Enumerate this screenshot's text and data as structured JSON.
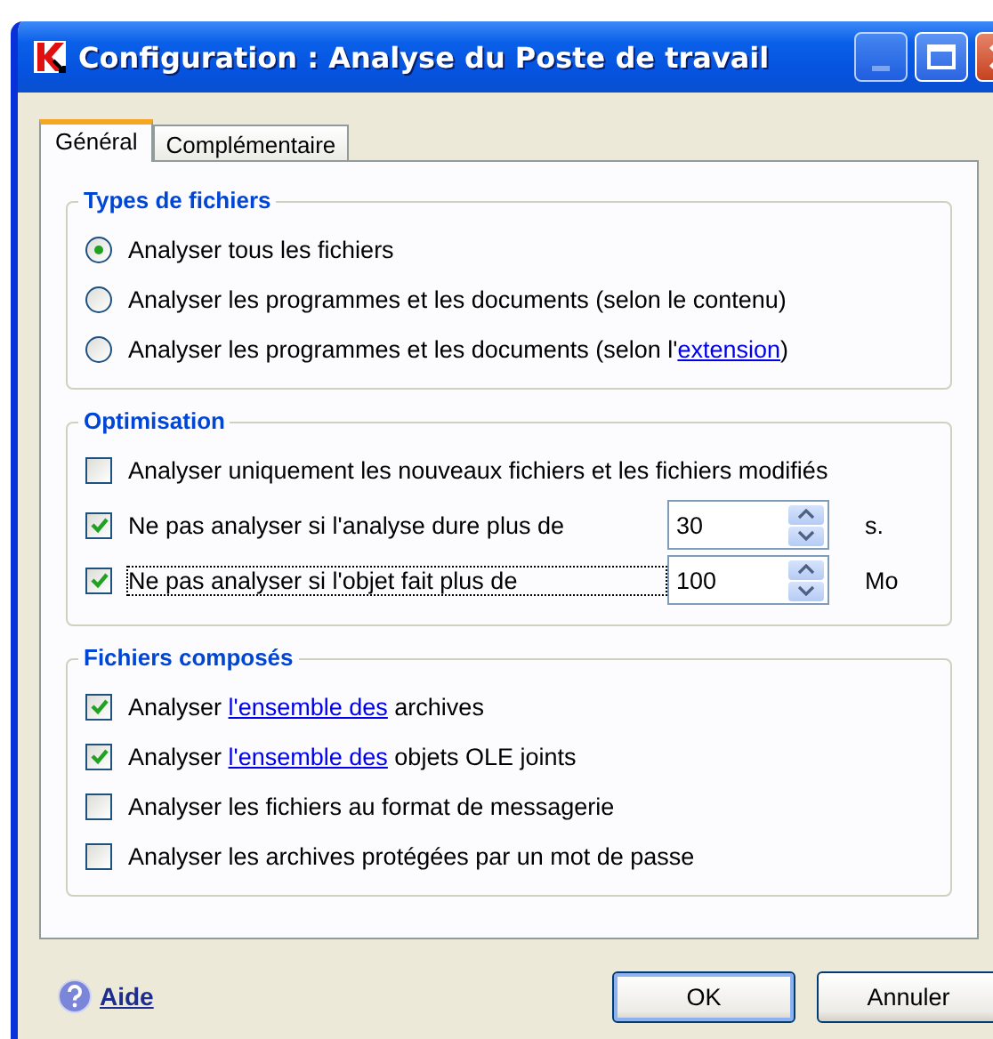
{
  "window": {
    "title": "Configuration : Analyse du Poste de travail"
  },
  "tabs": [
    {
      "label": "Général",
      "selected": true
    },
    {
      "label": "Complémentaire",
      "selected": false
    }
  ],
  "groups": [
    {
      "title": "Types de fichiers",
      "items": [
        {
          "kind": "radio",
          "text": "Analyser tous les fichiers",
          "selected": true
        },
        {
          "kind": "radio",
          "text": "Analyser les programmes et les documents (selon le contenu)",
          "selected": false
        },
        {
          "kind": "radio",
          "text": "Analyser les programmes et les documents (selon l'",
          "link": "extension",
          "after": ")",
          "selected": false
        }
      ]
    },
    {
      "title": "Optimisation",
      "items": [
        {
          "kind": "checkbox",
          "text": "Analyser uniquement les nouveaux fichiers et les fichiers modifiés",
          "checked": false
        },
        {
          "kind": "spin",
          "text": "Ne pas analyser si l'analyse dure plus de",
          "checked": true,
          "value": "30",
          "unit": "s.",
          "focused": false
        },
        {
          "kind": "spin",
          "text": "Ne pas analyser si l'objet fait plus de",
          "checked": true,
          "value": "100",
          "unit": "Mo",
          "focused": true
        }
      ]
    },
    {
      "title": "Fichiers composés",
      "items": [
        {
          "kind": "checkbox",
          "text": "Analyser ",
          "link": "l'ensemble des",
          "after": " archives",
          "checked": true
        },
        {
          "kind": "checkbox",
          "text": "Analyser ",
          "link": "l'ensemble des",
          "after": " objets OLE joints",
          "checked": true
        },
        {
          "kind": "checkbox",
          "text": "Analyser les fichiers au format de messagerie",
          "checked": false
        },
        {
          "kind": "checkbox",
          "text": "Analyser les archives protégées par un mot de passe",
          "checked": false
        }
      ]
    }
  ],
  "help_link": "Aide",
  "buttons": [
    {
      "label": "OK",
      "default": true
    },
    {
      "label": "Annuler",
      "default": false
    }
  ]
}
